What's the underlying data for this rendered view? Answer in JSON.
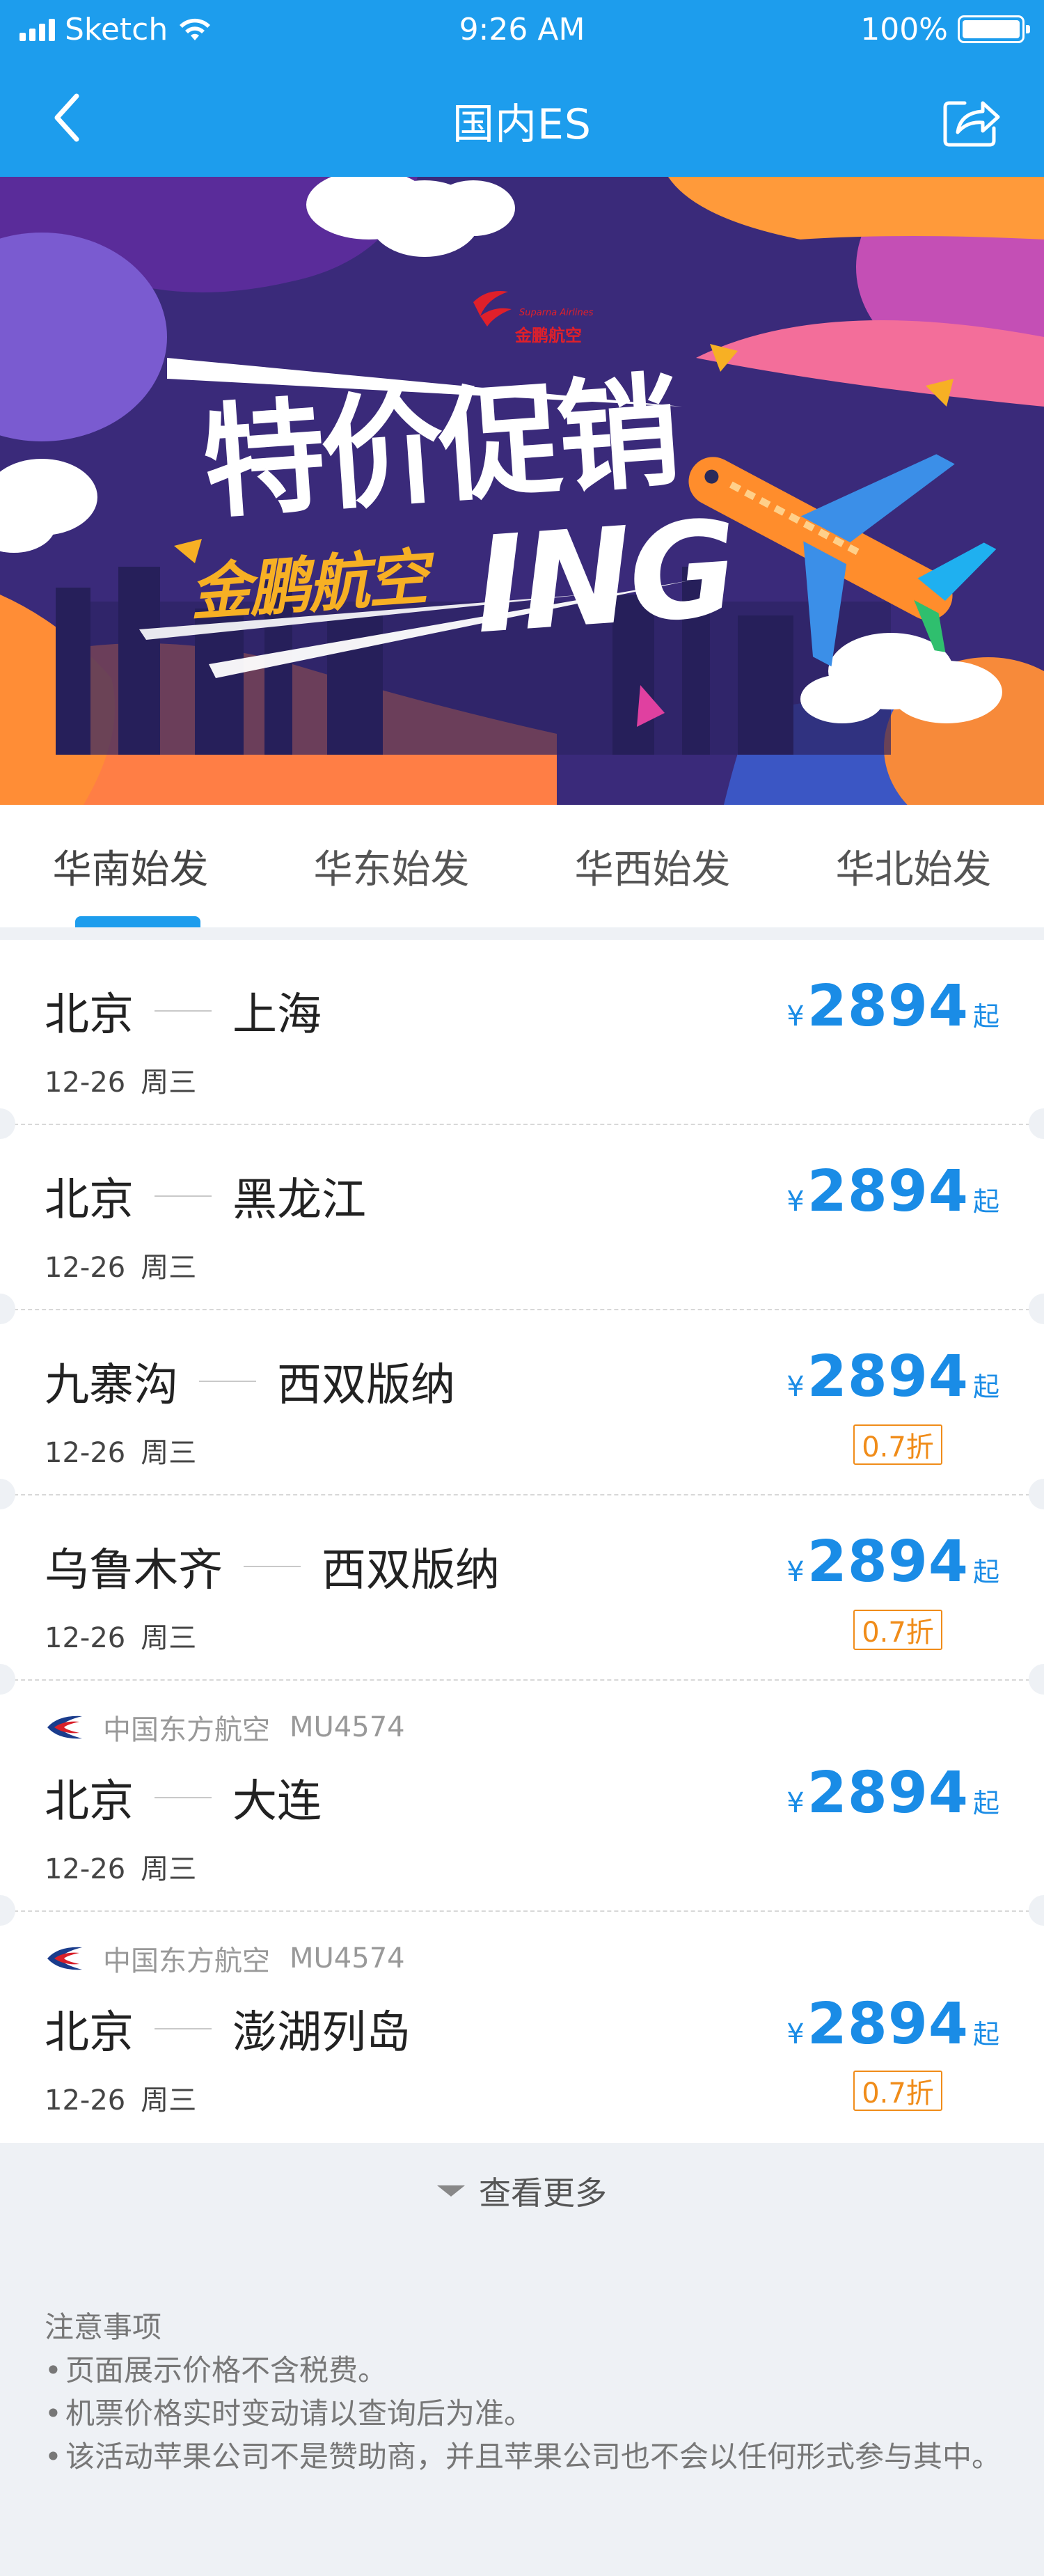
{
  "status_bar": {
    "carrier": "Sketch",
    "time": "9:26 AM",
    "battery_percent": "100%",
    "battery_level": 1.0
  },
  "nav": {
    "title": "国内ES",
    "back_icon": "chevron-left-icon",
    "share_icon": "share-icon"
  },
  "banner": {
    "headline": "特价促销",
    "suffix": "ING",
    "brand": "金鹏航空",
    "logo_text": "金鹏航空",
    "logo_en": "Suparna Airlines"
  },
  "tabs": [
    {
      "label": "华南始发",
      "active": true
    },
    {
      "label": "华东始发",
      "active": false
    },
    {
      "label": "华西始发",
      "active": false
    },
    {
      "label": "华北始发",
      "active": false
    }
  ],
  "routes": [
    {
      "from": "北京",
      "to": "上海",
      "date": "12-26",
      "weekday": "周三",
      "currency": "¥",
      "price": "2894",
      "suffix": "起",
      "discount": ""
    },
    {
      "from": "北京",
      "to": "黑龙江",
      "date": "12-26",
      "weekday": "周三",
      "currency": "¥",
      "price": "2894",
      "suffix": "起",
      "discount": ""
    },
    {
      "from": "九寨沟",
      "to": "西双版纳",
      "date": "12-26",
      "weekday": "周三",
      "currency": "¥",
      "price": "2894",
      "suffix": "起",
      "discount": "0.7折"
    },
    {
      "from": "乌鲁木齐",
      "to": "西双版纳",
      "date": "12-26",
      "weekday": "周三",
      "currency": "¥",
      "price": "2894",
      "suffix": "起",
      "discount": "0.7折"
    },
    {
      "airline": "中国东方航空",
      "flight": "MU4574",
      "airline_icon": "china-eastern-logo-icon",
      "from": "北京",
      "to": "大连",
      "date": "12-26",
      "weekday": "周三",
      "currency": "¥",
      "price": "2894",
      "suffix": "起",
      "discount": ""
    },
    {
      "airline": "中国东方航空",
      "flight": "MU4574",
      "airline_icon": "china-eastern-logo-icon",
      "from": "北京",
      "to": "澎湖列岛",
      "date": "12-26",
      "weekday": "周三",
      "currency": "¥",
      "price": "2894",
      "suffix": "起",
      "discount": "0.7折"
    }
  ],
  "see_more": "查看更多",
  "notice": {
    "title": "注意事项",
    "items": [
      "页面展示价格不含税费。",
      "机票价格实时变动请以查询后为准。",
      "该活动苹果公司不是赞助商，并且苹果公司也不会以任何形式参与其中。"
    ]
  },
  "colors": {
    "brand_blue": "#1d9ded",
    "price_blue": "#1a8ce6",
    "discount_orange": "#f08c19",
    "banner_purple": "#3a2a7a"
  }
}
